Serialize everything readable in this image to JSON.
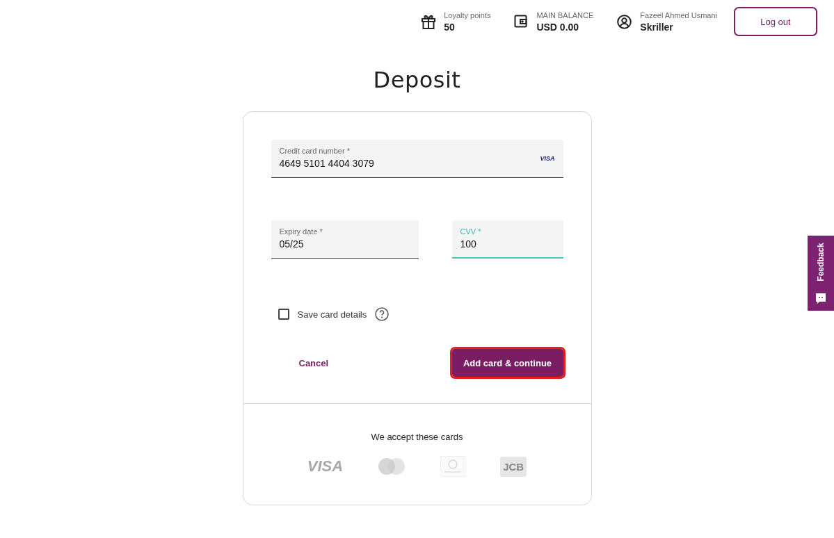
{
  "header": {
    "stats": [
      {
        "kind": "gift",
        "label": "Loyalty points",
        "value": "50"
      },
      {
        "kind": "wallet",
        "label": "MAIN BALANCE",
        "value": "USD 0.00"
      },
      {
        "kind": "user",
        "label": "Fazeel Ahmed Usmani",
        "value": "Skriller"
      }
    ],
    "logout": "Log out"
  },
  "title": "Deposit",
  "form": {
    "fields": [
      {
        "label": "Credit card number *",
        "value": "4649 5101 4404 3079",
        "brand": "VISA",
        "focused": false
      },
      {
        "label": "Expiry date *",
        "value": "05/25",
        "focused": false
      },
      {
        "label": "CVV *",
        "value": "100",
        "focused": true
      }
    ],
    "save_card": {
      "label": "Save card details",
      "checked": false
    },
    "cancel": "Cancel",
    "submit": {
      "label": "Add card & continue",
      "highlighted": true
    }
  },
  "accepted": {
    "heading": "We accept these cards",
    "cards": [
      {
        "kind": "visa",
        "text": "VISA"
      },
      {
        "kind": "mastercard"
      },
      {
        "kind": "diners"
      },
      {
        "kind": "jcb",
        "text": "JCB"
      }
    ]
  },
  "feedback": "Feedback"
}
